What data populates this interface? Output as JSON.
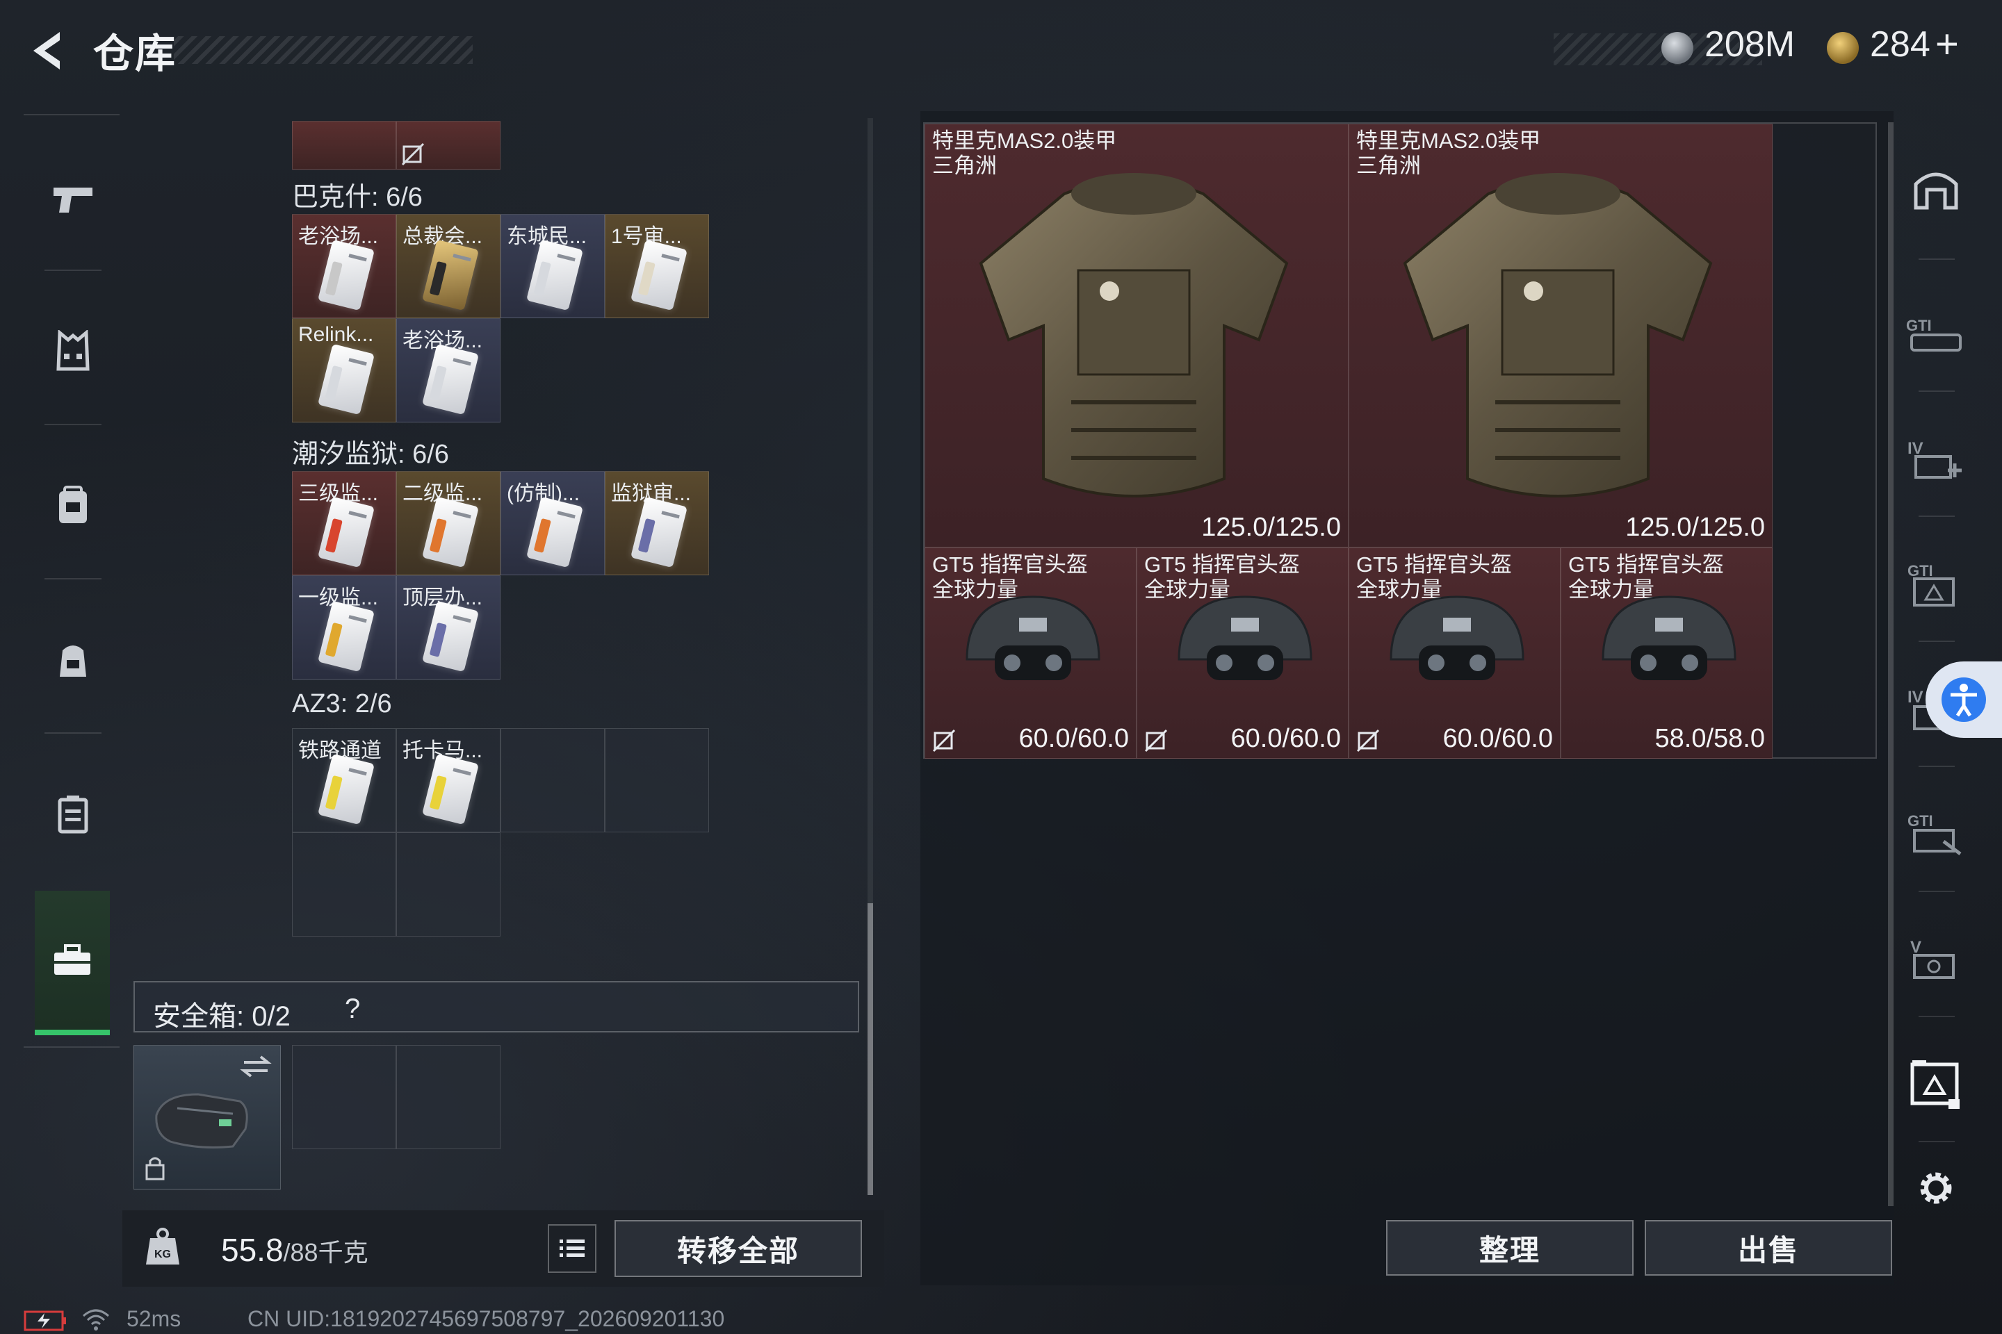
{
  "header": {
    "title": "仓库",
    "currency": [
      {
        "icon": "silver-coin-icon",
        "value": "208M"
      },
      {
        "icon": "gold-coin-icon",
        "value": "284",
        "suffix": "+"
      }
    ]
  },
  "left_nav": {
    "items": [
      {
        "icon": "pistol-icon"
      },
      {
        "icon": "armor-vest-icon"
      },
      {
        "icon": "chest-rig-icon"
      },
      {
        "icon": "backpack-icon"
      },
      {
        "icon": "case-icon"
      },
      {
        "icon": "toolbox-icon",
        "active": true
      }
    ]
  },
  "containers": {
    "sections": [
      {
        "title": "巴克什: 6/6",
        "slots": [
          {
            "label": "老浴场...",
            "rarity": "red"
          },
          {
            "label": "总裁会...",
            "rarity": "gold"
          },
          {
            "label": "东城民...",
            "rarity": "blue"
          },
          {
            "label": "1号审...",
            "rarity": "gold"
          },
          {
            "label": "Relink...",
            "rarity": "gold"
          },
          {
            "label": "老浴场...",
            "rarity": "blue"
          }
        ]
      },
      {
        "title": "潮汐监狱: 6/6",
        "slots": [
          {
            "label": "三级监...",
            "rarity": "red"
          },
          {
            "label": "二级监...",
            "rarity": "gold"
          },
          {
            "label": "(仿制)...",
            "rarity": "blue"
          },
          {
            "label": "监狱审...",
            "rarity": "gold"
          },
          {
            "label": "一级监...",
            "rarity": "blue"
          },
          {
            "label": "顶层办...",
            "rarity": "blue"
          }
        ]
      },
      {
        "title": "AZ3: 2/6",
        "slots": [
          {
            "label": "铁路通道",
            "rarity": "empty"
          },
          {
            "label": "托卡马...",
            "rarity": "empty"
          }
        ]
      }
    ],
    "safe_box": {
      "label": "安全箱: 0/2",
      "help": "?"
    }
  },
  "weight": {
    "current": "55.8",
    "max": "/88千克"
  },
  "buttons": {
    "transfer_all": "转移全部",
    "organize": "整理",
    "sell": "出售"
  },
  "stash": {
    "items": [
      {
        "name": "特里克MAS2.0装甲",
        "source": "三角洲",
        "durability": "125.0/125.0",
        "type": "armor"
      },
      {
        "name": "特里克MAS2.0装甲",
        "source": "三角洲",
        "durability": "125.0/125.0",
        "type": "armor"
      },
      {
        "name": "GT5 指挥官头盔",
        "source": "全球力量",
        "durability": "60.0/60.0",
        "type": "helmet",
        "unsellable": true
      },
      {
        "name": "GT5 指挥官头盔",
        "source": "全球力量",
        "durability": "60.0/60.0",
        "type": "helmet",
        "unsellable": true
      },
      {
        "name": "GT5 指挥官头盔",
        "source": "全球力量",
        "durability": "60.0/60.0",
        "type": "helmet",
        "unsellable": true
      },
      {
        "name": "GT5 指挥官头盔",
        "source": "全球力量",
        "durability": "58.0/58.0",
        "type": "helmet",
        "unsellable": false
      }
    ]
  },
  "right_nav": {
    "items": [
      {
        "icon": "arch-icon"
      },
      {
        "icon": "gti-weapon-icon"
      },
      {
        "icon": "iv-medkit-icon"
      },
      {
        "icon": "gti-box-icon"
      },
      {
        "icon": "iv-box-icon"
      },
      {
        "icon": "gti-tool-icon"
      },
      {
        "icon": "v-tool-icon"
      },
      {
        "icon": "key-box-icon"
      },
      {
        "icon": "settings-gear-icon"
      }
    ]
  },
  "status_bar": {
    "ping": "52ms",
    "uid": "CN UID:1819202745697508797_202609201130"
  },
  "colors": {
    "accent_green": "#36c46a",
    "item_red_bg": "#4e2a2e",
    "panel_bg": "#1b1f25"
  }
}
